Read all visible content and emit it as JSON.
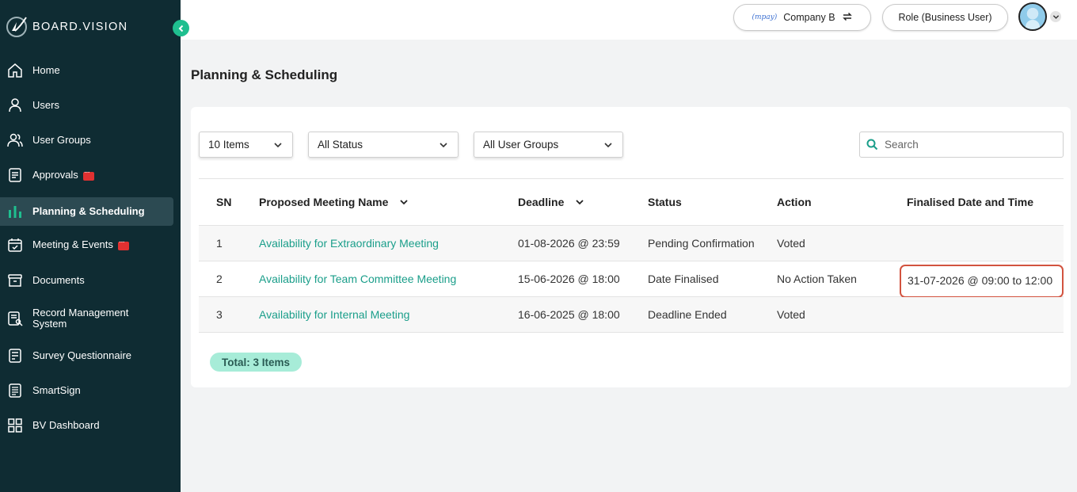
{
  "brand": {
    "name": "BOARD.VISION"
  },
  "sidebar": {
    "items": [
      {
        "label": "Home",
        "icon": "home-icon"
      },
      {
        "label": "Users",
        "icon": "user-icon"
      },
      {
        "label": "User Groups",
        "icon": "user-group-icon"
      },
      {
        "label": "Approvals",
        "icon": "approval-icon",
        "badge": true
      },
      {
        "label": "Planning & Scheduling",
        "icon": "chart-bars-icon",
        "active": true
      },
      {
        "label": "Meeting & Events",
        "icon": "calendar-check-icon",
        "badge": true
      },
      {
        "label": "Documents",
        "icon": "archive-icon"
      },
      {
        "label": "Record Management System",
        "icon": "record-search-icon"
      },
      {
        "label": "Survey Questionnaire",
        "icon": "survey-icon"
      },
      {
        "label": "SmartSign",
        "icon": "smartsign-icon"
      },
      {
        "label": "BV Dashboard",
        "icon": "dashboard-grid-icon"
      }
    ]
  },
  "topbar": {
    "company_logo": "(mpay)",
    "company": "Company B",
    "role": "Role (Business User)"
  },
  "page": {
    "title": "Planning & Scheduling"
  },
  "filters": {
    "items_per_page": "10 Items",
    "status": "All Status",
    "user_groups": "All User Groups",
    "search_placeholder": "Search"
  },
  "table": {
    "headers": [
      "SN",
      "Proposed Meeting Name",
      "Deadline",
      "Status",
      "Action",
      "Finalised Date and Time"
    ],
    "rows": [
      {
        "sn": "1",
        "name": "Availability for Extraordinary Meeting",
        "deadline": "01-08-2026 @ 23:59",
        "status": "Pending Confirmation",
        "action": "Voted",
        "finalised": ""
      },
      {
        "sn": "2",
        "name": "Availability for Team Committee Meeting",
        "deadline": "15-06-2026 @ 18:00",
        "status": "Date Finalised",
        "action": "No Action Taken",
        "finalised": "31-07-2026 @ 09:00 to 12:00"
      },
      {
        "sn": "3",
        "name": "Availability for Internal Meeting",
        "deadline": "16-06-2025 @ 18:00",
        "status": "Deadline Ended",
        "action": "Voted",
        "finalised": ""
      }
    ]
  },
  "total": "Total: 3 Items",
  "colors": {
    "sidebar_bg": "#0f2c33",
    "accent": "#1fbf8f",
    "link": "#1a9e8a",
    "highlight": "#d2533f",
    "total_badge": "#a7ecd8"
  }
}
